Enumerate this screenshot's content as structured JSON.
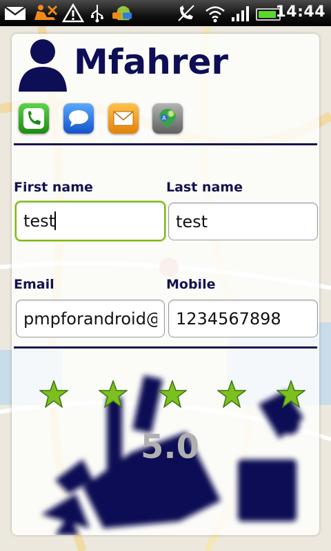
{
  "status_bar": {
    "time": "14:44",
    "icons": [
      "mail-icon",
      "car-crash-icon",
      "warning-icon",
      "usb-icon",
      "android-app-icon",
      "mute-icon",
      "wifi-icon",
      "signal-icon",
      "battery-icon"
    ],
    "battery_level": 0.9
  },
  "contact": {
    "name": "Mfahrer",
    "actions": [
      {
        "name": "call-icon",
        "color": "#2aa51a"
      },
      {
        "name": "message-icon",
        "color": "#1f6ee8"
      },
      {
        "name": "email-icon",
        "color": "#f29a14"
      },
      {
        "name": "navigate-icon",
        "color": "#8a8a8a"
      }
    ]
  },
  "form": {
    "first_name": {
      "label": "First name",
      "value": "test"
    },
    "last_name": {
      "label": "Last name",
      "value": "test"
    },
    "email": {
      "label": "Email",
      "value": "pmpforandroid@"
    },
    "mobile": {
      "label": "Mobile",
      "value": "1234567898"
    }
  },
  "rating": {
    "value": "5.0",
    "stars_filled": 5,
    "stars_total": 5,
    "star_color": "#7cc020",
    "art_color": "#0d0e55"
  },
  "colors": {
    "accent_text": "#12124f",
    "focus_border": "#7fb51f"
  }
}
